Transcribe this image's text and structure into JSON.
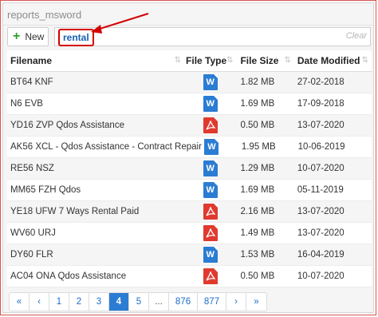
{
  "panel": {
    "title": "reports_msword"
  },
  "toolbar": {
    "new_label": "New",
    "search_value": "rental",
    "clear_label": "Clear"
  },
  "table": {
    "columns": [
      "Filename",
      "File Type",
      "File Size",
      "Date Modified"
    ],
    "rows": [
      {
        "filename": "BT64 KNF",
        "type": "word",
        "type_glyph": "W",
        "size": "1.82 MB",
        "date": "27-02-2018"
      },
      {
        "filename": "N6 EVB",
        "type": "word",
        "type_glyph": "W",
        "size": "1.69 MB",
        "date": "17-09-2018"
      },
      {
        "filename": "YD16 ZVP Qdos Assistance",
        "type": "pdf",
        "type_glyph": "",
        "size": "0.50 MB",
        "date": "13-07-2020"
      },
      {
        "filename": "AK56 XCL - Qdos Assistance - Contract Repair",
        "type": "word",
        "type_glyph": "W",
        "size": "1.95 MB",
        "date": "10-06-2019"
      },
      {
        "filename": "RE56 NSZ",
        "type": "word",
        "type_glyph": "W",
        "size": "1.29 MB",
        "date": "10-07-2020"
      },
      {
        "filename": "MM65 FZH Qdos",
        "type": "word",
        "type_glyph": "W",
        "size": "1.69 MB",
        "date": "05-11-2019"
      },
      {
        "filename": "YE18 UFW 7 Ways Rental Paid",
        "type": "pdf",
        "type_glyph": "",
        "size": "2.16 MB",
        "date": "13-07-2020"
      },
      {
        "filename": "WV60 URJ",
        "type": "pdf",
        "type_glyph": "",
        "size": "1.49 MB",
        "date": "13-07-2020"
      },
      {
        "filename": "DY60 FLR",
        "type": "word",
        "type_glyph": "W",
        "size": "1.53 MB",
        "date": "16-04-2019"
      },
      {
        "filename": "AC04 ONA Qdos Assistance",
        "type": "pdf",
        "type_glyph": "",
        "size": "0.50 MB",
        "date": "10-07-2020"
      }
    ]
  },
  "pagination": {
    "items": [
      "«",
      "‹",
      "1",
      "2",
      "3",
      "4",
      "5",
      "...",
      "876",
      "877",
      "›",
      "»"
    ],
    "active": "4"
  },
  "colors": {
    "word": "#2b7cd3",
    "pdf": "#e03a2f",
    "highlight": "#d40000",
    "active_page": "#2b7cd3"
  }
}
